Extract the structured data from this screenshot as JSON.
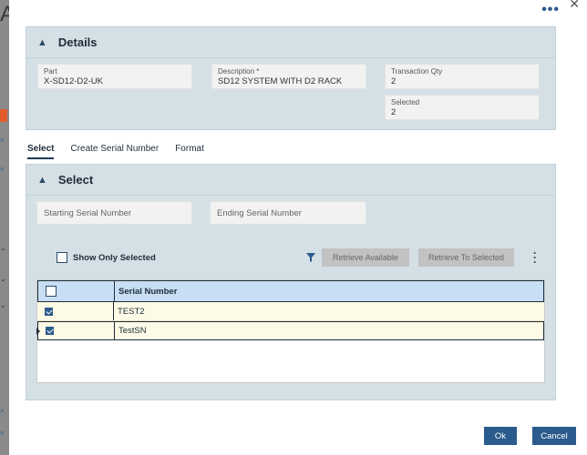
{
  "background": {
    "letter": "A"
  },
  "details": {
    "title": "Details",
    "part": {
      "label": "Part",
      "value": "X-SD12-D2-UK"
    },
    "description": {
      "label": "Description *",
      "value": "SD12 SYSTEM WITH D2 RACK"
    },
    "transaction_qty": {
      "label": "Transaction Qty",
      "value": "2"
    },
    "selected": {
      "label": "Selected",
      "value": "2"
    }
  },
  "tabs": [
    {
      "label": "Select",
      "active": true
    },
    {
      "label": "Create Serial Number",
      "active": false
    },
    {
      "label": "Format",
      "active": false
    }
  ],
  "select_panel": {
    "title": "Select",
    "starting_serial_placeholder": "Starting Serial Number",
    "ending_serial_placeholder": "Ending Serial Number",
    "show_only_selected_label": "Show Only Selected",
    "retrieve_available_label": "Retrieve Available",
    "retrieve_to_selected_label": "Retrieve To Selected"
  },
  "grid": {
    "column_header": "Serial Number",
    "rows": [
      {
        "serial": "TEST2",
        "checked": true
      },
      {
        "serial": "TestSN",
        "checked": true
      }
    ]
  },
  "footer": {
    "ok_label": "Ok",
    "cancel_label": "Cancel"
  },
  "colors": {
    "primary": "#2b5b8c",
    "panel_bg": "#d4e0e6",
    "grid_header": "#c7def4",
    "row_bg": "#fdfae6"
  }
}
